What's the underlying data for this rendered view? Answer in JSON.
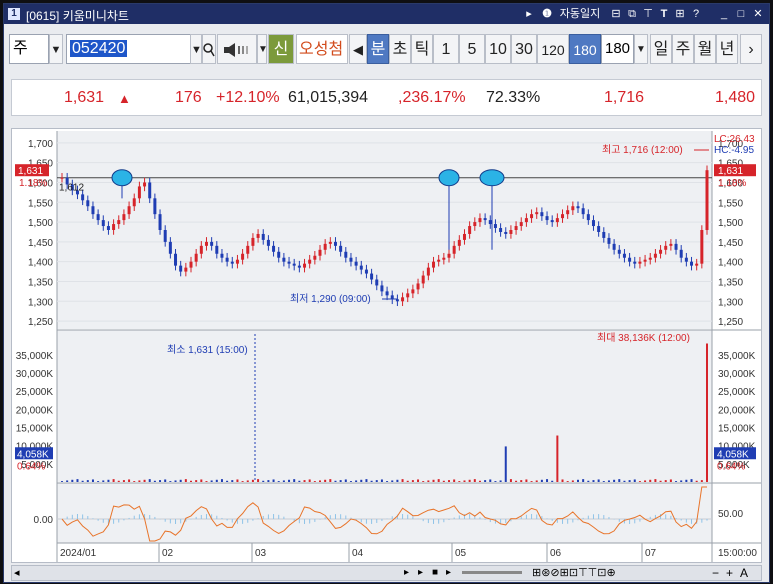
{
  "window": {
    "title": "[0615] 키움미니차트",
    "title_icon": "1",
    "controls": {
      "play": "▸",
      "autolog_icon": "❶",
      "autolog": "자동일지",
      "minimize": "_",
      "maximize": "□",
      "close": "✕",
      "help": "?"
    }
  },
  "toolbar": {
    "market": "주",
    "code": "052420",
    "new_label": "신",
    "name": "오성첨",
    "periods": [
      "분",
      "초",
      "틱",
      "1",
      "5",
      "10",
      "30",
      "120",
      "180"
    ],
    "period_value": "180",
    "views": [
      "일",
      "주",
      "월",
      "년"
    ],
    "next": "›"
  },
  "quote": {
    "price": "1,631",
    "arrow": "▲",
    "change": "176",
    "rate": "+12.10%",
    "volume": "61,015,394",
    "vol_rate": ",236.17%",
    "ratio": "72.33%",
    "high": "1,716",
    "low": "1,480"
  },
  "chart": {
    "lc": "LC:26.43",
    "hc": "HC:-4.95",
    "current_price_label": "1,631",
    "current_pct_label": "1.18%",
    "prev_close_label": "1,612",
    "max_label": "최고 1,716 (12:00)",
    "min_label": "최저 1,290 (09:00)",
    "vol_max_label": "최대 38,136K (12:00)",
    "vol_min_label": "최소 1,631 (15:00)",
    "vol_current_label": "4,058K",
    "vol_current_pct": "0.64%",
    "price_ticks": [
      "1,700",
      "1,650",
      "1,600",
      "1,550",
      "1,500",
      "1,450",
      "1,400",
      "1,350",
      "1,300",
      "1,250"
    ],
    "vol_ticks": [
      "35,000K",
      "30,000K",
      "25,000K",
      "20,000K",
      "15,000K",
      "10,000K",
      "5,000K"
    ],
    "osc_left": "0.00",
    "osc_right": "50.00",
    "x_labels": [
      "2024/01",
      "02",
      "03",
      "04",
      "05",
      "06",
      "07"
    ],
    "time_label": "15:00:00"
  },
  "chart_data": {
    "type": "candlestick",
    "title": "",
    "ylim": [
      1230,
      1730
    ],
    "series": [
      {
        "values": [
          1612,
          1595,
          1580,
          1570,
          1555,
          1540,
          1520,
          1505,
          1490,
          1480,
          1495,
          1505,
          1520,
          1540,
          1560,
          1590,
          1600,
          1560,
          1520,
          1480,
          1450,
          1420,
          1390,
          1375,
          1385,
          1400,
          1420,
          1440,
          1450,
          1440,
          1420,
          1410,
          1400,
          1395,
          1405,
          1420,
          1440,
          1460,
          1470,
          1455,
          1440,
          1425,
          1410,
          1400,
          1395,
          1390,
          1385,
          1395,
          1405,
          1415,
          1430,
          1445,
          1450,
          1440,
          1425,
          1410,
          1400,
          1390,
          1380,
          1370,
          1355,
          1340,
          1325,
          1315,
          1305,
          1300,
          1310,
          1320,
          1330,
          1345,
          1365,
          1385,
          1400,
          1405,
          1410,
          1420,
          1440,
          1455,
          1470,
          1490,
          1500,
          1510,
          1505,
          1495,
          1485,
          1475,
          1470,
          1480,
          1490,
          1500,
          1510,
          1520,
          1525,
          1515,
          1505,
          1500,
          1510,
          1520,
          1530,
          1540,
          1535,
          1520,
          1505,
          1490,
          1475,
          1460,
          1445,
          1430,
          1420,
          1410,
          1400,
          1395,
          1400,
          1405,
          1410,
          1420,
          1430,
          1440,
          1445,
          1430,
          1410,
          1400,
          1390,
          1395,
          1480,
          1631
        ]
      }
    ]
  },
  "icons": {
    "search": "search-icon",
    "speaker": "speaker-icon",
    "arrow_left": "triangle-left-icon"
  },
  "status": {
    "scroll_left": "◂",
    "scroll_right": "▸",
    "zoom_minus": "−",
    "zoom_plus": "+",
    "text_tool": "A"
  }
}
